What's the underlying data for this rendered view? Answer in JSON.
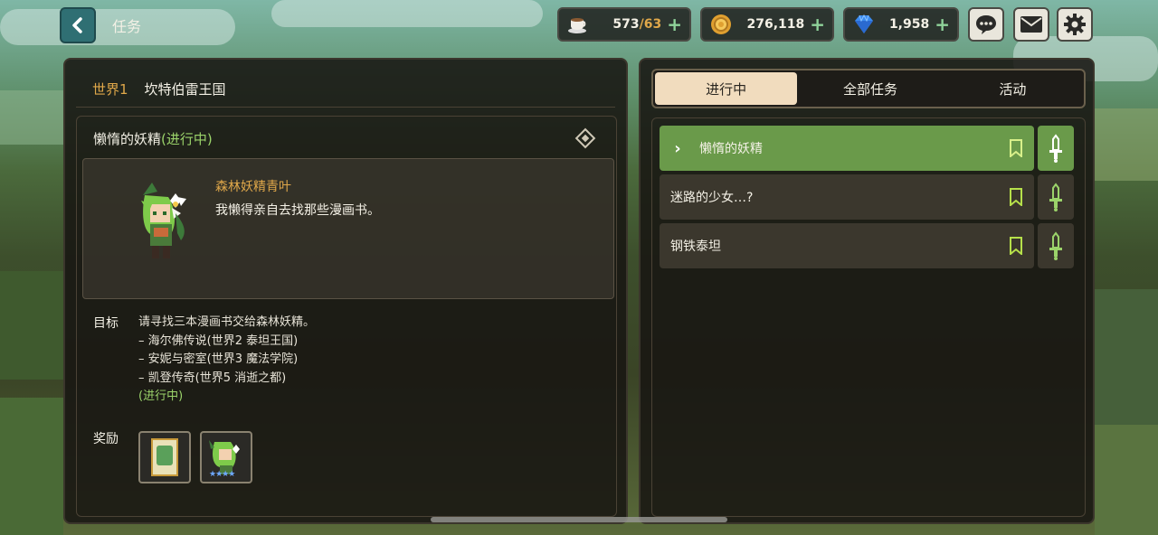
{
  "header": {
    "title": "任务",
    "resources": {
      "stamina": {
        "value": "573",
        "cap": "/63",
        "icon": "coffee-cup-icon"
      },
      "gold": {
        "value": "276,118",
        "icon": "gold-coin-icon"
      },
      "gems": {
        "value": "1,958",
        "icon": "diamond-icon"
      }
    },
    "icons": [
      "chat-icon",
      "mail-icon",
      "gear-icon"
    ]
  },
  "left": {
    "world_tag": "世界1",
    "world_name": "坎特伯雷王国",
    "quest": {
      "title": "懒惰的妖精",
      "status": "(进行中)",
      "npc_name": "森林妖精青叶",
      "npc_line": "我懒得亲自去找那些漫画书。"
    },
    "goal_label": "目标",
    "goal_lines": [
      "请寻找三本漫画书交给森林妖精。",
      "–  海尔佛传说(世界2  泰坦王国)",
      "–  安妮与密室(世界3  魔法学院)",
      "–  凯登传奇(世界5  消逝之都)"
    ],
    "goal_status": "(进行中)",
    "reward_label": "奖励"
  },
  "right": {
    "tabs": [
      "进行中",
      "全部任务",
      "活动"
    ],
    "active_tab": 0,
    "quests": [
      {
        "name": "懒惰的妖精",
        "active": true
      },
      {
        "name": "迷路的少女…?",
        "active": false
      },
      {
        "name": "钢铁泰坦",
        "active": false
      }
    ]
  },
  "colors": {
    "accent_orange": "#e0a84a",
    "status_green": "#9bd36a",
    "active_row": "#6a9a4a",
    "tab_active": "#f1dcbe"
  }
}
